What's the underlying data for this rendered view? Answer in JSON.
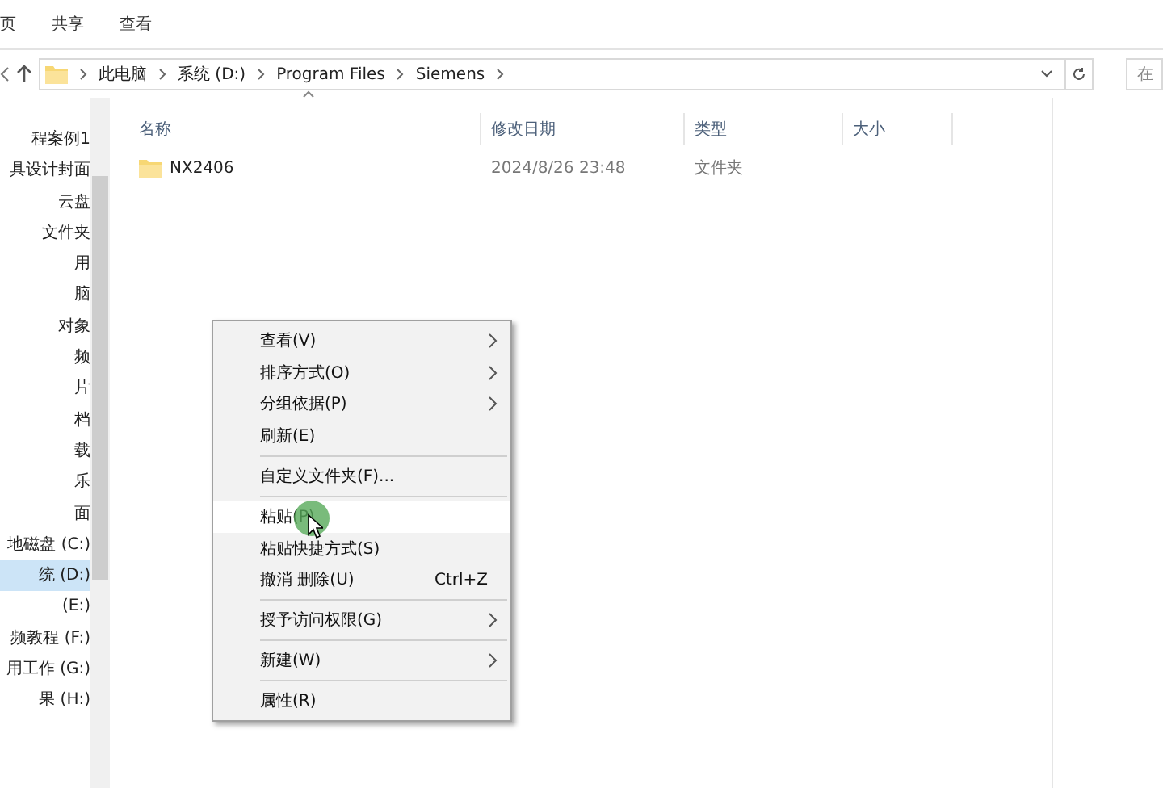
{
  "ribbon": {
    "tabs": [
      {
        "label": "页",
        "selected": false
      },
      {
        "label": "共享",
        "selected": false
      },
      {
        "label": "查看",
        "selected": false
      }
    ]
  },
  "address_bar": {
    "path": [
      "此电脑",
      "系统 (D:)",
      "Program Files",
      "Siemens"
    ]
  },
  "search": {
    "placeholder": "在"
  },
  "sidebar": {
    "items": [
      {
        "label": "程案例1",
        "selected": false
      },
      {
        "label": "具设计封面",
        "selected": false
      },
      {
        "label": "云盘",
        "selected": false
      },
      {
        "label": "文件夹",
        "selected": false
      },
      {
        "label": "用",
        "selected": false
      },
      {
        "label": "脑",
        "selected": false
      },
      {
        "label": "对象",
        "selected": false
      },
      {
        "label": "频",
        "selected": false
      },
      {
        "label": "片",
        "selected": false
      },
      {
        "label": "档",
        "selected": false
      },
      {
        "label": "载",
        "selected": false
      },
      {
        "label": "乐",
        "selected": false
      },
      {
        "label": "面",
        "selected": false
      },
      {
        "label": "地磁盘 (C:)",
        "selected": false
      },
      {
        "label": "统 (D:)",
        "selected": true
      },
      {
        "label": "(E:)",
        "selected": false
      },
      {
        "label": "频教程 (F:)",
        "selected": false
      },
      {
        "label": "用工作 (G:)",
        "selected": false
      },
      {
        "label": "果 (H:)",
        "selected": false
      }
    ]
  },
  "table": {
    "columns": [
      "名称",
      "修改日期",
      "类型",
      "大小"
    ],
    "rows": [
      {
        "name": "NX2406",
        "modified": "2024/8/26 23:48",
        "type": "文件夹",
        "size": ""
      }
    ]
  },
  "context_menu": {
    "items": [
      {
        "kind": "item",
        "label": "查看(V)",
        "submenu": true,
        "selected": false
      },
      {
        "kind": "item",
        "label": "排序方式(O)",
        "submenu": true,
        "selected": false
      },
      {
        "kind": "item",
        "label": "分组依据(P)",
        "submenu": true,
        "selected": false
      },
      {
        "kind": "item",
        "label": "刷新(E)",
        "submenu": false,
        "selected": false
      },
      {
        "kind": "separator"
      },
      {
        "kind": "item",
        "label": "自定义文件夹(F)...",
        "submenu": false,
        "selected": false
      },
      {
        "kind": "separator"
      },
      {
        "kind": "item",
        "label": "粘贴(P)",
        "submenu": false,
        "selected": true
      },
      {
        "kind": "item",
        "label": "粘贴快捷方式(S)",
        "submenu": false,
        "selected": false
      },
      {
        "kind": "item",
        "label": "撤消 删除(U)",
        "shortcut": "Ctrl+Z",
        "submenu": false,
        "selected": false
      },
      {
        "kind": "separator"
      },
      {
        "kind": "item",
        "label": "授予访问权限(G)",
        "submenu": true,
        "selected": false
      },
      {
        "kind": "separator"
      },
      {
        "kind": "item",
        "label": "新建(W)",
        "submenu": true,
        "selected": false
      },
      {
        "kind": "separator"
      },
      {
        "kind": "item",
        "label": "属性(R)",
        "submenu": false,
        "selected": false
      }
    ]
  }
}
